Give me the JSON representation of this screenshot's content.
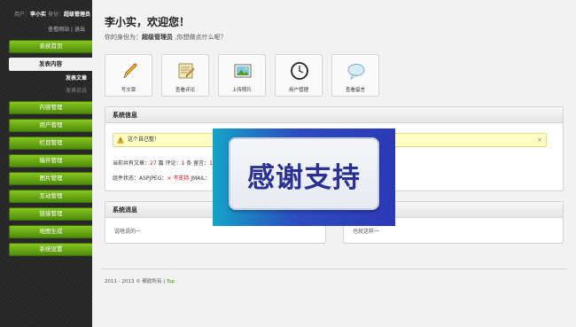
{
  "sidebar": {
    "user_prefix": "用户：",
    "user_name": "李小实",
    "role_prefix": "身份：",
    "role_name": "超级管理员",
    "links": [
      "查看网站",
      "退出"
    ],
    "link_sep": "|",
    "nav_top": "系统首页",
    "nav_active": "发表内容",
    "sub_items": [
      "发表文章",
      "发表说说"
    ],
    "nav_items": [
      "内容管理",
      "用户管理",
      "栏目管理",
      "稿件管理",
      "图片管理",
      "互动管理",
      "链接管理",
      "地图生成",
      "系统设置"
    ]
  },
  "header": {
    "greeting": "李小实，欢迎您！",
    "role_prefix": "你的身份为：",
    "role": "超级管理员",
    "role_suffix": " ,你想做点什么呢？"
  },
  "quick_actions": [
    {
      "label": "写文章",
      "icon": "pencil-icon"
    },
    {
      "label": "查看评论",
      "icon": "comment-edit-icon"
    },
    {
      "label": "上传照片",
      "icon": "photo-upload-icon"
    },
    {
      "label": "用户管理",
      "icon": "clock-icon"
    },
    {
      "label": "查看留言",
      "icon": "speech-bubble-icon"
    }
  ],
  "system_info": {
    "title": "系统信息",
    "alert": "这个自己整！",
    "alert_close": "×",
    "stats_line": {
      "prefix": "当前共有文章：",
      "articles": "27",
      "c_label": " 篇 评论：",
      "comments": "1",
      "m_label": " 条 留言：",
      "messages": "1"
    },
    "component_line": {
      "prefix": "组件状态：",
      "asp_jpeg": "ASPJPEG：",
      "unsupported": "× 不支持",
      "jmail": " JMAIL："
    }
  },
  "messages": {
    "title": "系统消息",
    "left_text": "说啥说的一",
    "right_text": "也就这样一"
  },
  "footer": {
    "text": "2011 - 2013 © 都欧所有 | ",
    "top": "Top"
  },
  "overlay": {
    "text": "感谢支持"
  },
  "colors": {
    "nav_green_top": "#84c51f",
    "nav_green_bottom": "#4f8d0b",
    "alert_bg": "#fffdc4",
    "red": "#d01010"
  }
}
